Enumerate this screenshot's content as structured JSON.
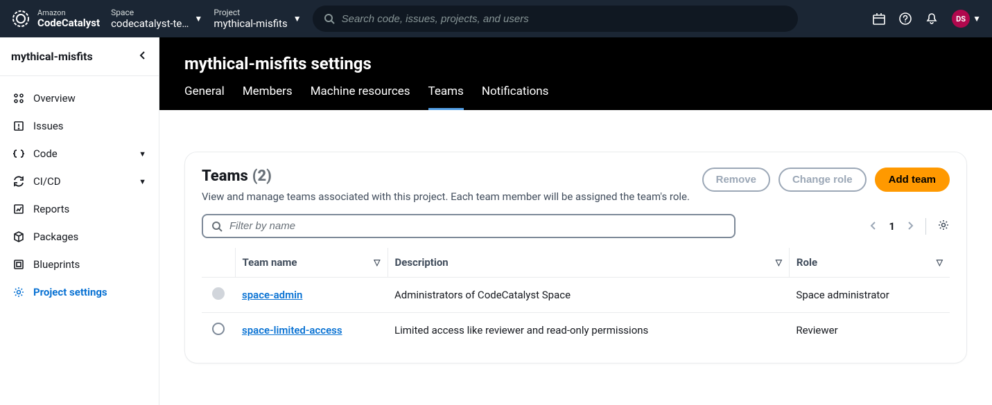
{
  "brand": {
    "top": "Amazon",
    "name": "CodeCatalyst"
  },
  "context": {
    "space_label": "Space",
    "space_value": "codecatalyst-te…",
    "project_label": "Project",
    "project_value": "mythical-misfits"
  },
  "search": {
    "placeholder": "Search code, issues, projects, and users"
  },
  "user": {
    "initials": "DS"
  },
  "sidebar": {
    "title": "mythical-misfits",
    "items": [
      {
        "label": "Overview"
      },
      {
        "label": "Issues"
      },
      {
        "label": "Code"
      },
      {
        "label": "CI/CD"
      },
      {
        "label": "Reports"
      },
      {
        "label": "Packages"
      },
      {
        "label": "Blueprints"
      },
      {
        "label": "Project settings"
      }
    ]
  },
  "page": {
    "title": "mythical-misfits settings",
    "tabs": [
      "General",
      "Members",
      "Machine resources",
      "Teams",
      "Notifications"
    ]
  },
  "panel": {
    "title": "Teams",
    "count": "(2)",
    "description": "View and manage teams associated with this project. Each team member will be assigned the team's role.",
    "actions": {
      "remove": "Remove",
      "change_role": "Change role",
      "add_team": "Add team"
    },
    "filter_placeholder": "Filter by name",
    "page_number": "1"
  },
  "table": {
    "columns": {
      "name": "Team name",
      "description": "Description",
      "role": "Role"
    },
    "rows": [
      {
        "name": "space-admin",
        "description": "Administrators of CodeCatalyst Space",
        "role": "Space administrator"
      },
      {
        "name": "space-limited-access",
        "description": "Limited access like reviewer and read-only permissions",
        "role": "Reviewer"
      }
    ]
  }
}
